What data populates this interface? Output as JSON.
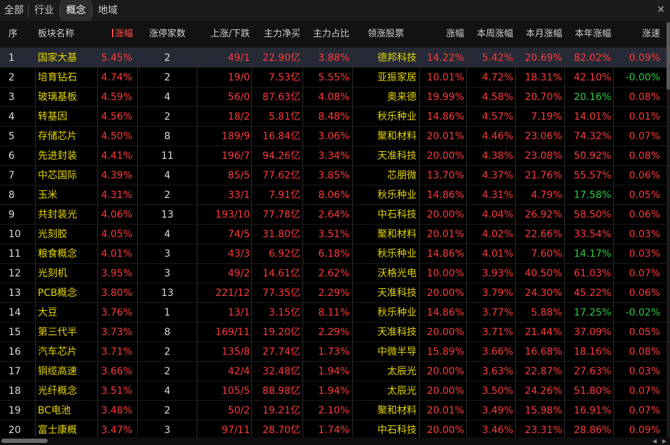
{
  "tabs": [
    {
      "label": "全部",
      "active": false
    },
    {
      "label": "行业",
      "active": false
    },
    {
      "label": "概念",
      "active": true
    },
    {
      "label": "地域",
      "active": false
    }
  ],
  "close_glyph": "✕",
  "columns": {
    "idx": "序",
    "name": "板块名称",
    "chg": "涨幅",
    "limit": "涨停家数",
    "updown": "上涨/下跌",
    "netbuy": "主力净买",
    "ratio": "主力占比",
    "leader": "领涨股票",
    "lchg": "涨幅",
    "week": "本周涨幅",
    "month": "本月涨幅",
    "year": "本年涨幅",
    "speed": "涨速"
  },
  "colors": {
    "up": "#ff3b3b",
    "down": "#2ecc40",
    "name": "#e6d600",
    "neutral": "#dddddd"
  },
  "rows": [
    {
      "idx": "1",
      "name": "国家大基",
      "chg": "5.45%",
      "limit": "2",
      "updown": "49/1",
      "netbuy": "22.90亿",
      "ratio": "3.88%",
      "leader": "德邦科技",
      "lchg": "14.22%",
      "week": "5.42%",
      "month": "20.69%",
      "year": "82.02%",
      "speed": "0.09%"
    },
    {
      "idx": "2",
      "name": "培育钻石",
      "chg": "4.74%",
      "limit": "2",
      "updown": "19/0",
      "netbuy": "7.53亿",
      "ratio": "5.55%",
      "leader": "亚振家居",
      "lchg": "10.01%",
      "week": "4.72%",
      "month": "18.31%",
      "year": "42.10%",
      "speed": "-0.00%"
    },
    {
      "idx": "3",
      "name": "玻璃基板",
      "chg": "4.59%",
      "limit": "4",
      "updown": "56/0",
      "netbuy": "87.63亿",
      "ratio": "4.08%",
      "leader": "奥来德",
      "lchg": "19.99%",
      "week": "4.58%",
      "month": "20.70%",
      "year": "20.16%",
      "speed": "0.08%"
    },
    {
      "idx": "4",
      "name": "转基因",
      "chg": "4.56%",
      "limit": "2",
      "updown": "18/2",
      "netbuy": "5.81亿",
      "ratio": "8.48%",
      "leader": "秋乐种业",
      "lchg": "14.86%",
      "week": "4.57%",
      "month": "7.19%",
      "year": "14.01%",
      "speed": "0.01%"
    },
    {
      "idx": "5",
      "name": "存储芯片",
      "chg": "4.50%",
      "limit": "8",
      "updown": "189/9",
      "netbuy": "16.84亿",
      "ratio": "3.06%",
      "leader": "聚和材料",
      "lchg": "20.01%",
      "week": "4.46%",
      "month": "23.06%",
      "year": "74.32%",
      "speed": "0.07%"
    },
    {
      "idx": "6",
      "name": "先进封装",
      "chg": "4.41%",
      "limit": "11",
      "updown": "196/7",
      "netbuy": "94.26亿",
      "ratio": "3.34%",
      "leader": "天准科技",
      "lchg": "20.00%",
      "week": "4.38%",
      "month": "23.08%",
      "year": "50.92%",
      "speed": "0.08%"
    },
    {
      "idx": "7",
      "name": "中芯国际",
      "chg": "4.39%",
      "limit": "4",
      "updown": "85/5",
      "netbuy": "77.62亿",
      "ratio": "3.85%",
      "leader": "芯朋微",
      "lchg": "13.70%",
      "week": "4.37%",
      "month": "21.76%",
      "year": "55.57%",
      "speed": "0.06%"
    },
    {
      "idx": "8",
      "name": "玉米",
      "chg": "4.31%",
      "limit": "2",
      "updown": "33/1",
      "netbuy": "7.91亿",
      "ratio": "8.06%",
      "leader": "秋乐种业",
      "lchg": "14.86%",
      "week": "4.31%",
      "month": "4.79%",
      "year": "17.58%",
      "speed": "0.05%"
    },
    {
      "idx": "9",
      "name": "共封装光",
      "chg": "4.06%",
      "limit": "13",
      "updown": "193/10",
      "netbuy": "77.78亿",
      "ratio": "2.64%",
      "leader": "中石科技",
      "lchg": "20.00%",
      "week": "4.04%",
      "month": "26.92%",
      "year": "58.50%",
      "speed": "0.06%"
    },
    {
      "idx": "10",
      "name": "光刻胶",
      "chg": "4.05%",
      "limit": "4",
      "updown": "74/5",
      "netbuy": "31.80亿",
      "ratio": "3.51%",
      "leader": "聚和材料",
      "lchg": "20.01%",
      "week": "4.02%",
      "month": "22.66%",
      "year": "33.54%",
      "speed": "0.03%"
    },
    {
      "idx": "11",
      "name": "粮食概念",
      "chg": "4.01%",
      "limit": "3",
      "updown": "43/3",
      "netbuy": "6.92亿",
      "ratio": "6.18%",
      "leader": "秋乐种业",
      "lchg": "14.86%",
      "week": "4.01%",
      "month": "7.60%",
      "year": "14.17%",
      "speed": "0.03%"
    },
    {
      "idx": "12",
      "name": "光刻机",
      "chg": "3.95%",
      "limit": "3",
      "updown": "49/2",
      "netbuy": "14.61亿",
      "ratio": "2.62%",
      "leader": "沃格光电",
      "lchg": "10.00%",
      "week": "3.93%",
      "month": "40.50%",
      "year": "61.03%",
      "speed": "0.07%"
    },
    {
      "idx": "13",
      "name": "PCB概念",
      "chg": "3.80%",
      "limit": "13",
      "updown": "221/12",
      "netbuy": "77.35亿",
      "ratio": "2.29%",
      "leader": "天准科技",
      "lchg": "20.00%",
      "week": "3.79%",
      "month": "24.30%",
      "year": "45.22%",
      "speed": "0.06%"
    },
    {
      "idx": "14",
      "name": "大豆",
      "chg": "3.76%",
      "limit": "1",
      "updown": "13/1",
      "netbuy": "3.15亿",
      "ratio": "8.11%",
      "leader": "秋乐种业",
      "lchg": "14.86%",
      "week": "3.77%",
      "month": "5.88%",
      "year": "17.25%",
      "speed": "-0.02%"
    },
    {
      "idx": "15",
      "name": "第三代半",
      "chg": "3.73%",
      "limit": "8",
      "updown": "169/11",
      "netbuy": "19.20亿",
      "ratio": "2.29%",
      "leader": "天准科技",
      "lchg": "20.00%",
      "week": "3.71%",
      "month": "21.44%",
      "year": "37.09%",
      "speed": "0.05%"
    },
    {
      "idx": "16",
      "name": "汽车芯片",
      "chg": "3.71%",
      "limit": "2",
      "updown": "135/8",
      "netbuy": "27.74亿",
      "ratio": "1.73%",
      "leader": "中微半导",
      "lchg": "15.89%",
      "week": "3.66%",
      "month": "16.68%",
      "year": "18.16%",
      "speed": "0.08%"
    },
    {
      "idx": "17",
      "name": "铜缆高速",
      "chg": "3.66%",
      "limit": "2",
      "updown": "42/4",
      "netbuy": "32.48亿",
      "ratio": "1.94%",
      "leader": "太辰光",
      "lchg": "20.00%",
      "week": "3.63%",
      "month": "22.87%",
      "year": "27.63%",
      "speed": "0.03%"
    },
    {
      "idx": "18",
      "name": "光纤概念",
      "chg": "3.51%",
      "limit": "4",
      "updown": "105/5",
      "netbuy": "88.98亿",
      "ratio": "1.94%",
      "leader": "太辰光",
      "lchg": "20.00%",
      "week": "3.50%",
      "month": "24.26%",
      "year": "51.80%",
      "speed": "0.07%"
    },
    {
      "idx": "19",
      "name": "BC电池",
      "chg": "3.48%",
      "limit": "2",
      "updown": "50/2",
      "netbuy": "19.21亿",
      "ratio": "2.10%",
      "leader": "聚和材料",
      "lchg": "20.01%",
      "week": "3.49%",
      "month": "15.98%",
      "year": "16.91%",
      "speed": "0.07%"
    },
    {
      "idx": "20",
      "name": "富士康概",
      "chg": "3.47%",
      "limit": "3",
      "updown": "97/11",
      "netbuy": "28.70亿",
      "ratio": "1.74%",
      "leader": "中石科技",
      "lchg": "20.00%",
      "week": "3.46%",
      "month": "23.31%",
      "year": "28.86%",
      "speed": "0.09%"
    }
  ]
}
